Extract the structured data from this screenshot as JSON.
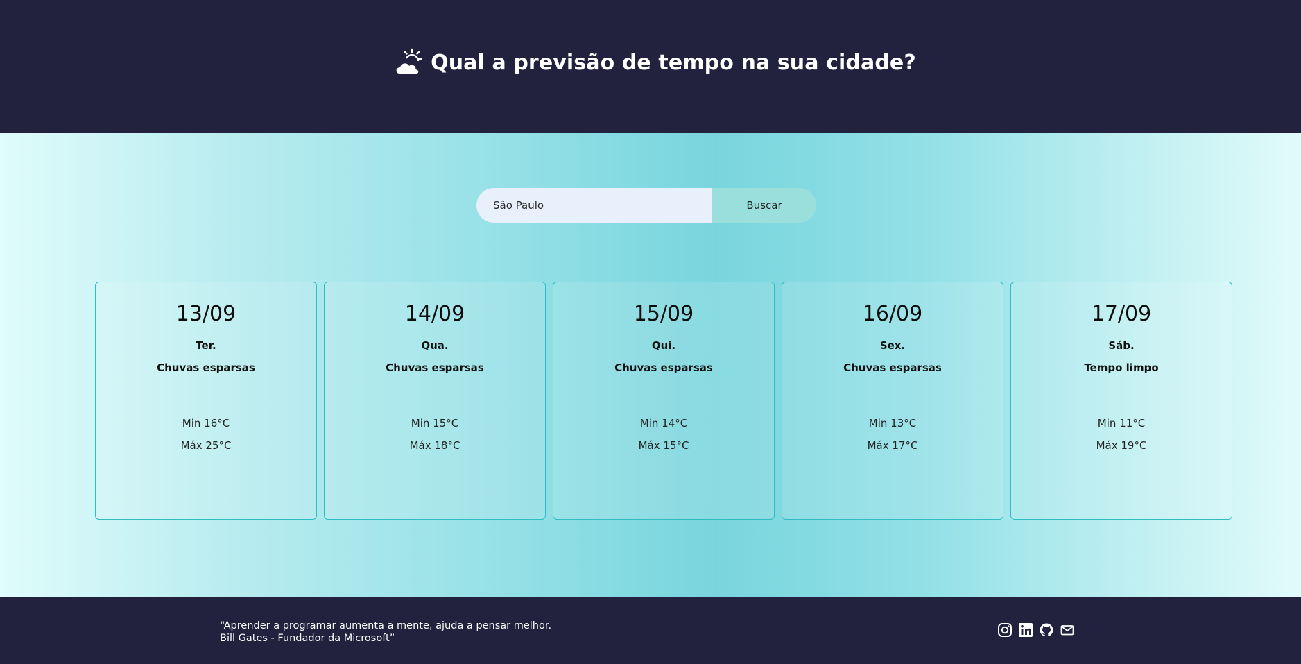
{
  "header": {
    "title": "Qual a previsão de tempo na sua cidade?",
    "icon": "partly-cloudy-sun-icon"
  },
  "search": {
    "value": "São Paulo",
    "button_label": "Buscar"
  },
  "forecast": [
    {
      "date": "13/09",
      "weekday": "Ter.",
      "description": "Chuvas esparsas",
      "min": "Min 16°C",
      "max": "Máx 25°C"
    },
    {
      "date": "14/09",
      "weekday": "Qua.",
      "description": "Chuvas esparsas",
      "min": "Min 15°C",
      "max": "Máx 18°C"
    },
    {
      "date": "15/09",
      "weekday": "Qui.",
      "description": "Chuvas esparsas",
      "min": "Min 14°C",
      "max": "Máx 15°C"
    },
    {
      "date": "16/09",
      "weekday": "Sex.",
      "description": "Chuvas esparsas",
      "min": "Min 13°C",
      "max": "Máx 17°C"
    },
    {
      "date": "17/09",
      "weekday": "Sáb.",
      "description": "Tempo limpo",
      "min": "Min 11°C",
      "max": "Máx 19°C"
    }
  ],
  "footer": {
    "quote_line1": "“Aprender a programar aumenta a mente, ajuda a pensar melhor.",
    "quote_line2": "Bill Gates - Fundador da Microsoft”",
    "social_icons": [
      "instagram-icon",
      "linkedin-icon",
      "github-icon",
      "mail-icon"
    ]
  },
  "colors": {
    "header_bg": "#22223f",
    "card_border": "#2fbec0",
    "search_input_bg": "#e7f0fb",
    "search_button_bg": "#9bdfdc"
  }
}
